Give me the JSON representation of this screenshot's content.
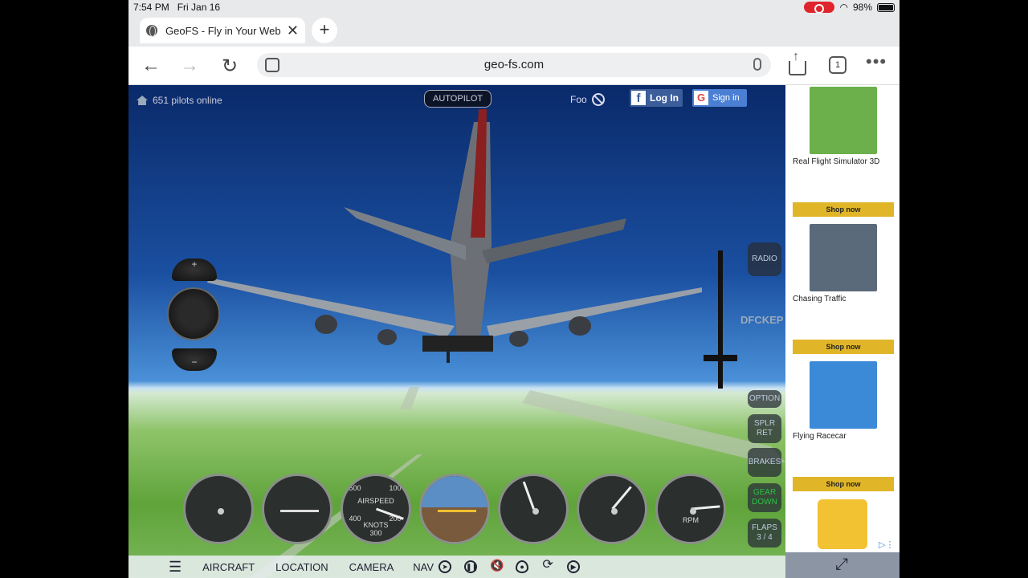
{
  "status_bar": {
    "time": "7:54 PM",
    "date": "Fri Jan 16",
    "battery": "98%",
    "battery_fraction": 0.98
  },
  "browser": {
    "tab_title": "GeoFS - Fly in Your Web",
    "url": "geo-fs.com",
    "tab_count": "1"
  },
  "game": {
    "pilots_online": "651 pilots online",
    "autopilot": "AUTOPILOT",
    "user": "Foo",
    "fb_login": "Log In",
    "google_signin": "Sign in",
    "callsign": "DFCKEP",
    "side_buttons": {
      "radio": "RADIO",
      "option": "OPTION",
      "splr": "SPLR",
      "ret": "RET",
      "brakes": "BRAKES",
      "gear": "GEAR",
      "down": "DOWN",
      "flaps": "FLAPS",
      "flaps_value": "3 / 4"
    },
    "joystick": {
      "plus": "+",
      "minus": "−"
    },
    "gauges": {
      "airspeed_label": "AIRSPEED",
      "knots_label": "KNOTS",
      "rpm_label": "RPM",
      "scale_500": "500",
      "scale_100": "100",
      "scale_400": "400",
      "scale_300": "300",
      "scale_200": "200"
    },
    "bottom_menu": {
      "aircraft": "AIRCRAFT",
      "location": "LOCATION",
      "camera": "CAMERA",
      "nav": "NAV"
    }
  },
  "ads": [
    {
      "title": "Real Flight Simulator 3D",
      "button": "Shop now",
      "color": "#6bb04a"
    },
    {
      "title": "Chasing Traffic",
      "button": "Shop now",
      "color": "#5a6a7a"
    },
    {
      "title": "Flying Racecar",
      "button": "Shop now",
      "color": "#3a8ad8"
    }
  ],
  "colors": {
    "accent_yellow": "#e0b628",
    "sky": "#1a4fa0",
    "record_red": "#e0242b"
  }
}
